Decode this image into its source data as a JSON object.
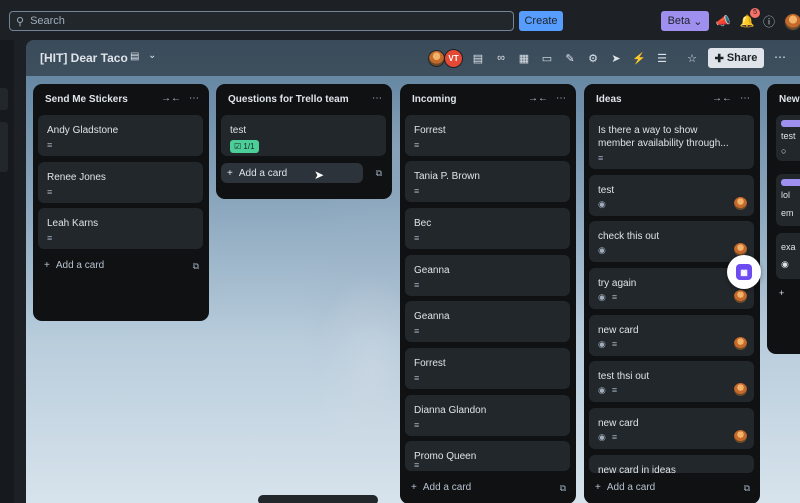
{
  "topbar": {
    "search_placeholder": "Search",
    "create_label": "Create",
    "beta_label": "Beta",
    "notification_count": "5",
    "icons": [
      "megaphone-icon",
      "bell-icon",
      "help-icon"
    ]
  },
  "board": {
    "title": "[HIT] Dear Taco",
    "member_initials": "VT",
    "share_label": "Share"
  },
  "lists": [
    {
      "title": "Send Me Stickers",
      "cards": [
        {
          "text": "Andy Gladstone"
        },
        {
          "text": "Renee Jones"
        },
        {
          "text": "Leah Karns"
        }
      ],
      "add_label": "Add a card"
    },
    {
      "title": "Questions for Trello team",
      "cards": [
        {
          "text": "test",
          "checklist": "1/1"
        }
      ],
      "add_label": "Add a card"
    },
    {
      "title": "Incoming",
      "cards": [
        {
          "text": "Forrest"
        },
        {
          "text": "Tania P. Brown"
        },
        {
          "text": "Bec"
        },
        {
          "text": "Geanna"
        },
        {
          "text": "Geanna"
        },
        {
          "text": "Forrest"
        },
        {
          "text": "Dianna Glandon"
        },
        {
          "text": "Promo Queen"
        }
      ],
      "add_label": "Add a card"
    },
    {
      "title": "Ideas",
      "cards": [
        {
          "text": "Is there a way to show member availability through..."
        },
        {
          "text": "test"
        },
        {
          "text": "check this out"
        },
        {
          "text": "try again"
        },
        {
          "text": "new card"
        },
        {
          "text": "test thsi out"
        },
        {
          "text": "new card"
        },
        {
          "text": "new card in ideas"
        }
      ],
      "add_label": "Add a card"
    }
  ],
  "partial_list": {
    "title": "New",
    "cards": [
      {
        "text": "test"
      },
      {
        "text": "lol"
      },
      {
        "text": "em"
      },
      {
        "text": "exa"
      }
    ]
  },
  "colors": {
    "accent": "#579dff",
    "beta": "#9f8fef",
    "checklist_complete": "#4bce97",
    "badge": "#f87168",
    "list_bg": "#0f1113",
    "card_bg": "#22272b"
  }
}
